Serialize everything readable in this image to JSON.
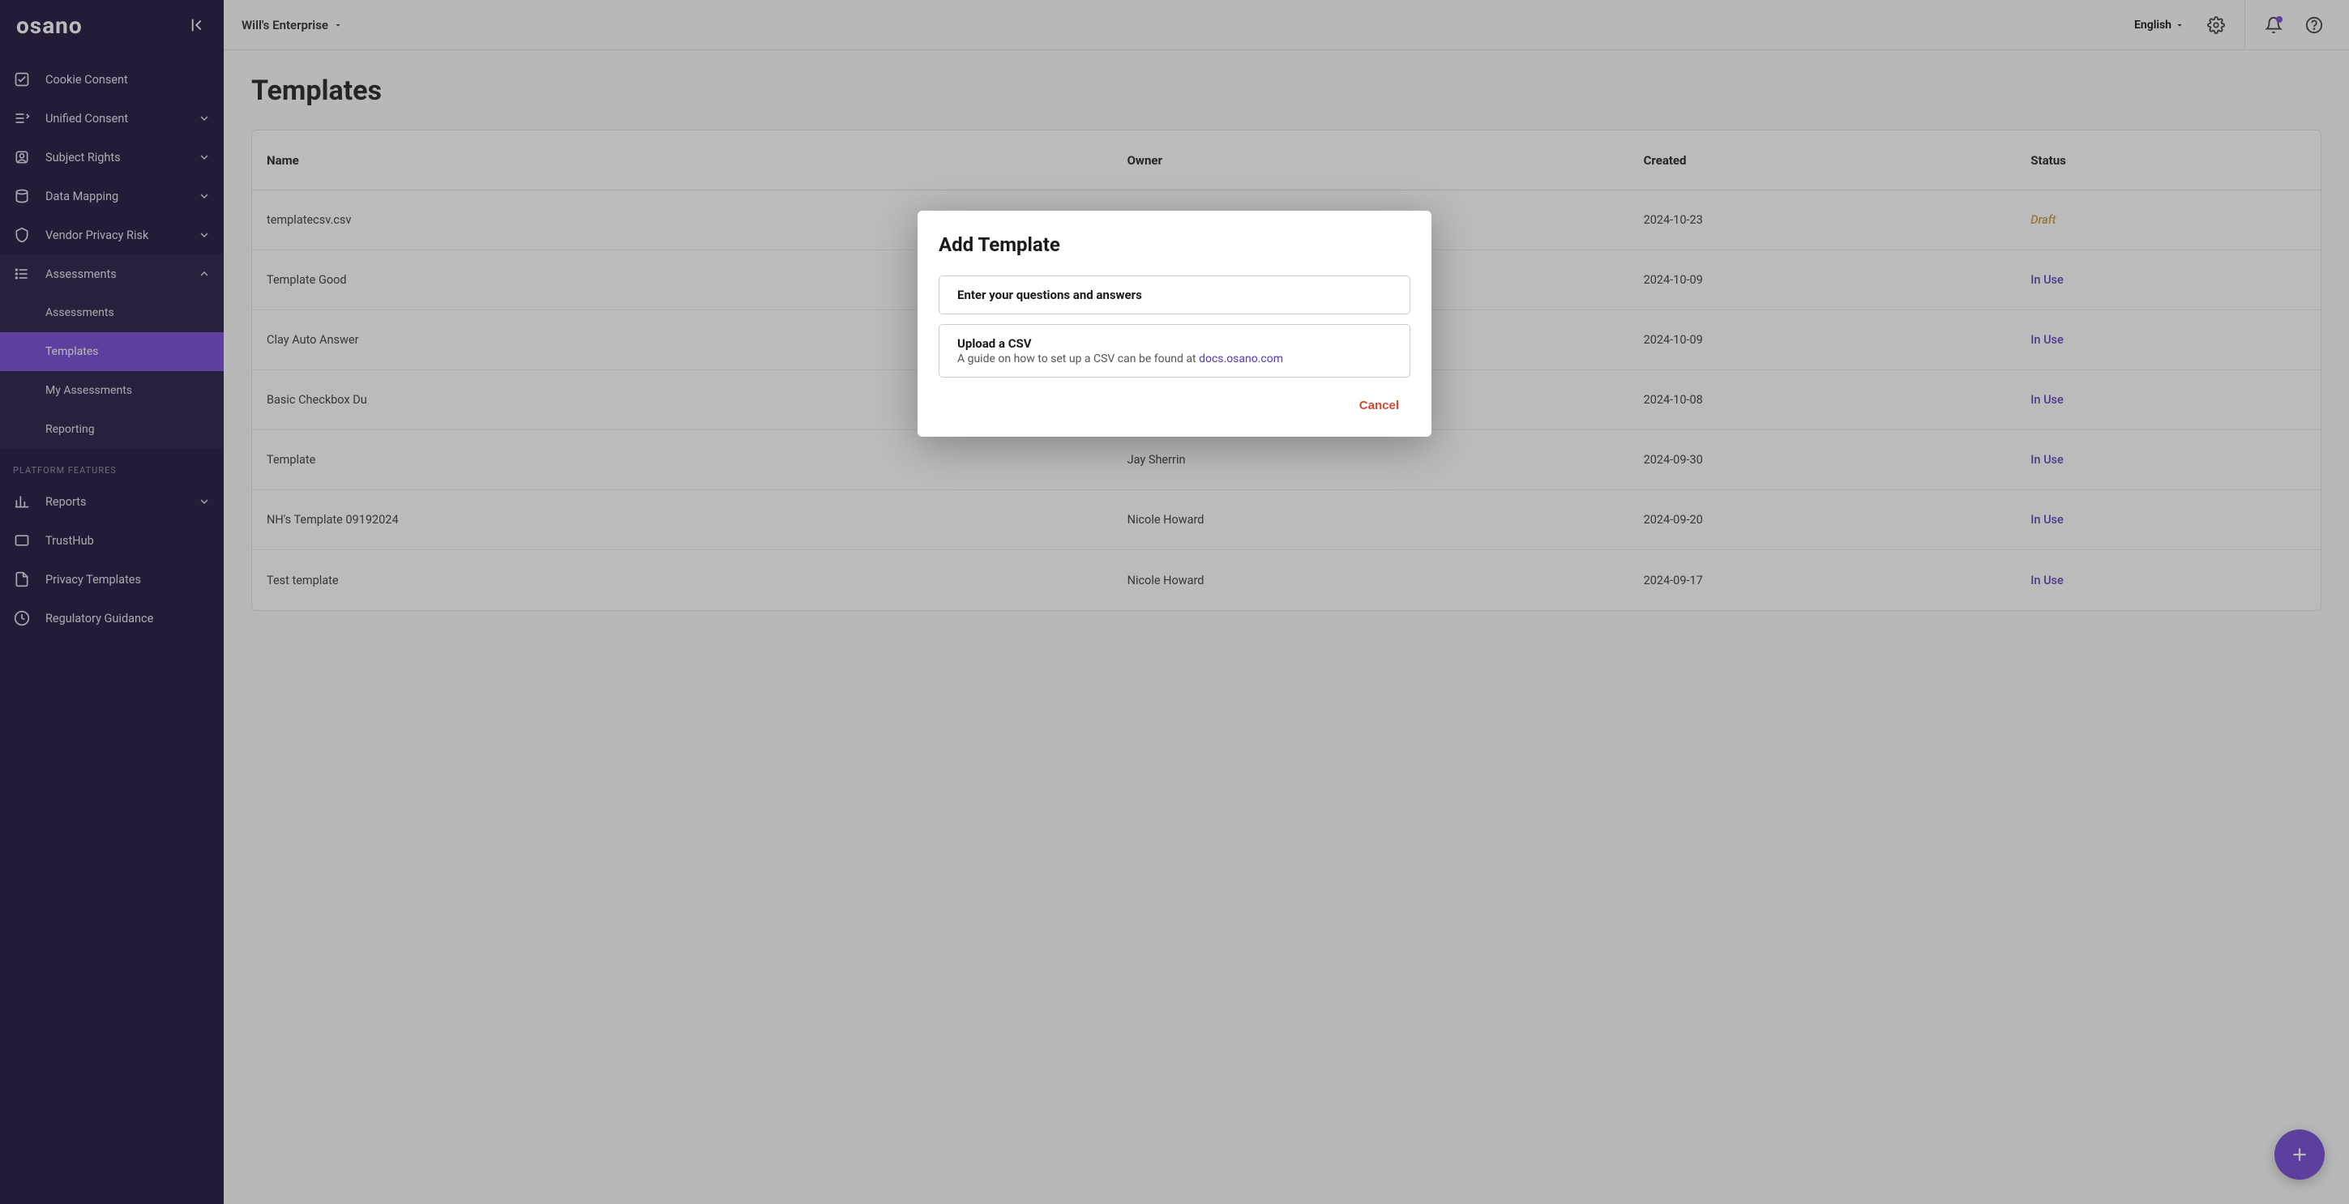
{
  "brand": "osano",
  "topbar": {
    "org_name": "Will's Enterprise",
    "language": "English"
  },
  "sidebar": {
    "items": [
      {
        "label": "Cookie Consent",
        "icon": "cookie-consent-icon",
        "expandable": false
      },
      {
        "label": "Unified Consent",
        "icon": "unified-consent-icon",
        "expandable": true
      },
      {
        "label": "Subject Rights",
        "icon": "subject-rights-icon",
        "expandable": true
      },
      {
        "label": "Data Mapping",
        "icon": "data-mapping-icon",
        "expandable": true
      },
      {
        "label": "Vendor Privacy Risk",
        "icon": "vendor-risk-icon",
        "expandable": true
      },
      {
        "label": "Assessments",
        "icon": "assessments-icon",
        "expandable": true,
        "open": true
      }
    ],
    "assessments_sub": [
      {
        "label": "Assessments"
      },
      {
        "label": "Templates",
        "active": true
      },
      {
        "label": "My Assessments"
      },
      {
        "label": "Reporting"
      }
    ],
    "section_header": "PLATFORM FEATURES",
    "platform_items": [
      {
        "label": "Reports",
        "icon": "reports-icon",
        "expandable": true
      },
      {
        "label": "TrustHub",
        "icon": "trusthub-icon"
      },
      {
        "label": "Privacy Templates",
        "icon": "privacy-templates-icon"
      },
      {
        "label": "Regulatory Guidance",
        "icon": "regulatory-icon"
      }
    ]
  },
  "page": {
    "title": "Templates",
    "columns": {
      "name": "Name",
      "owner": "Owner",
      "created": "Created",
      "status": "Status"
    },
    "rows": [
      {
        "name": "templatecsv.csv",
        "owner": "",
        "created": "2024-10-23",
        "status": "Draft",
        "status_class": "draft"
      },
      {
        "name": "Template Good",
        "owner": "",
        "created": "2024-10-09",
        "status": "In Use",
        "status_class": "inuse"
      },
      {
        "name": "Clay Auto Answer",
        "owner": "",
        "created": "2024-10-09",
        "status": "In Use",
        "status_class": "inuse"
      },
      {
        "name": "Basic Checkbox Du",
        "owner": "",
        "created": "2024-10-08",
        "status": "In Use",
        "status_class": "inuse"
      },
      {
        "name": "Template",
        "owner": "Jay Sherrin",
        "created": "2024-09-30",
        "status": "In Use",
        "status_class": "inuse"
      },
      {
        "name": "NH's Template 09192024",
        "owner": "Nicole Howard",
        "created": "2024-09-20",
        "status": "In Use",
        "status_class": "inuse"
      },
      {
        "name": "Test template",
        "owner": "Nicole Howard",
        "created": "2024-09-17",
        "status": "In Use",
        "status_class": "inuse"
      }
    ]
  },
  "modal": {
    "title": "Add Template",
    "option1": {
      "title": "Enter your questions and answers"
    },
    "option2": {
      "title": "Upload a CSV",
      "subtitle_prefix": "A guide on how to set up a CSV can be found at ",
      "link_text": "docs.osano.com"
    },
    "cancel": "Cancel"
  }
}
